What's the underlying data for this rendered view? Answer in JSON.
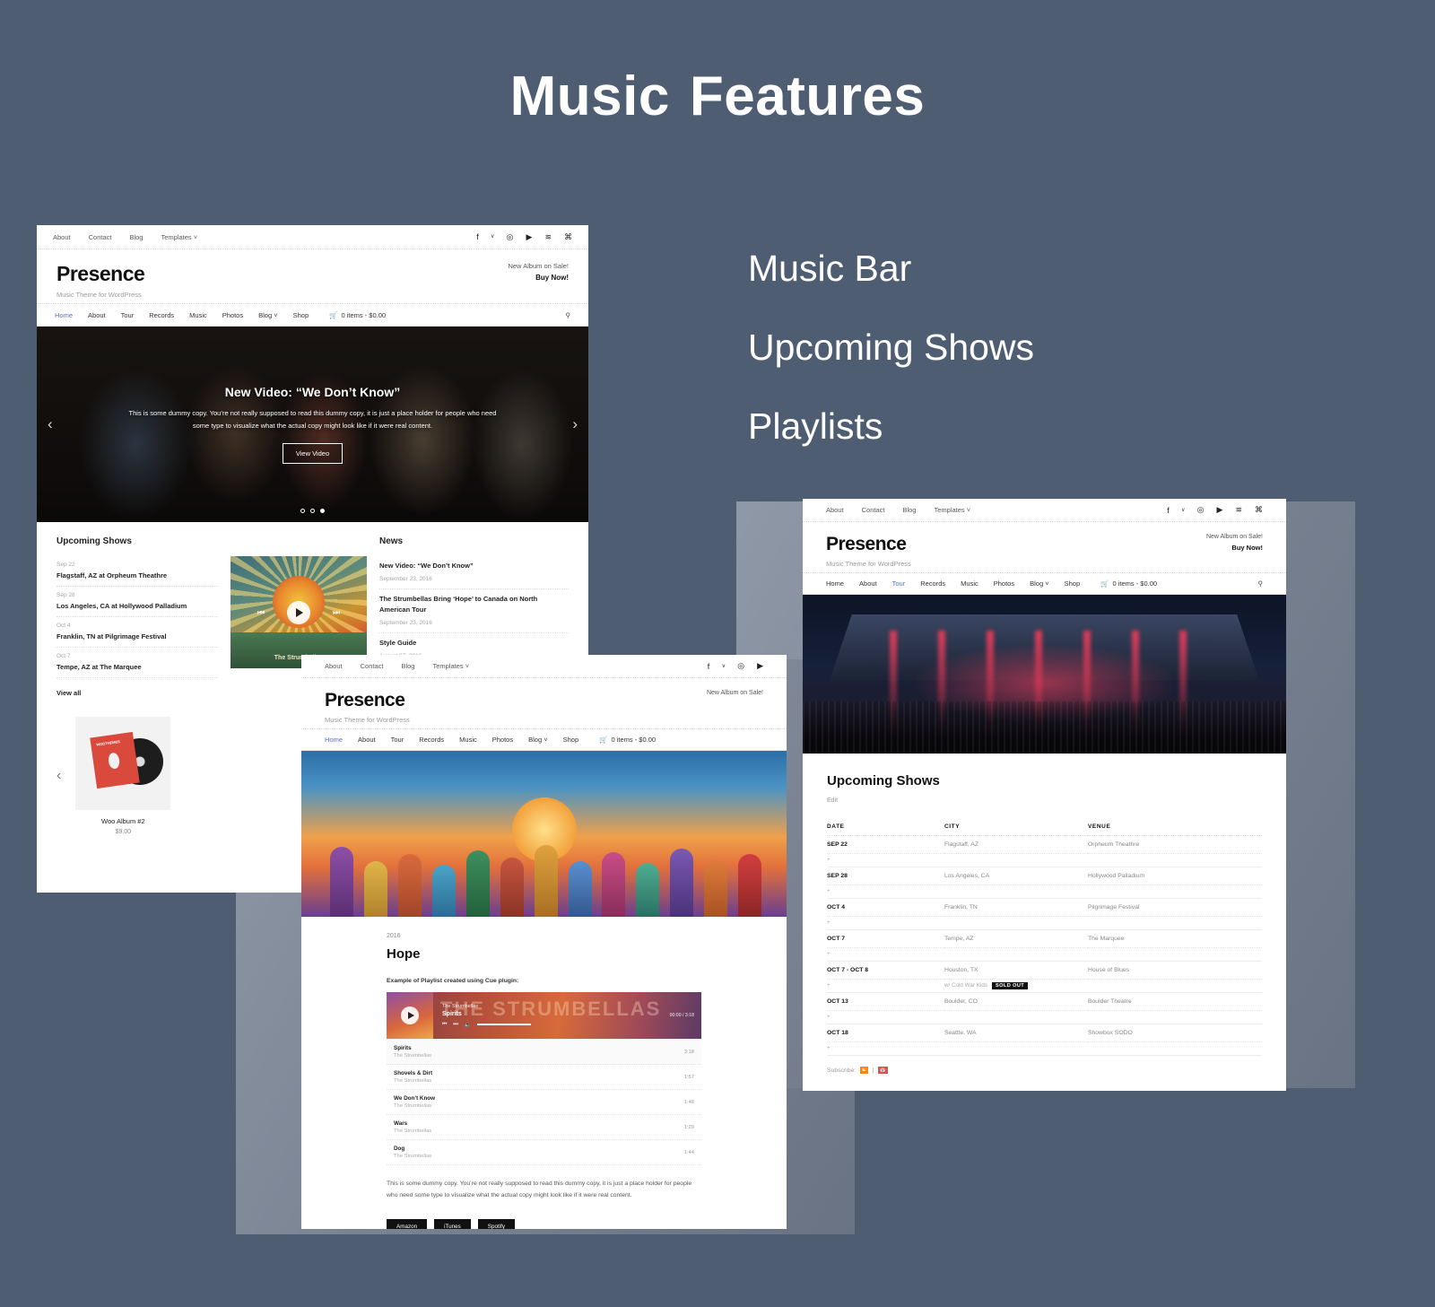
{
  "header": {
    "title_part1": "Music",
    "title_part2": "Features"
  },
  "features": [
    {
      "label": "Music Bar"
    },
    {
      "label": "Upcoming Shows"
    },
    {
      "label": "Playlists"
    }
  ],
  "site": {
    "brand": "Presence",
    "tagline": "Music Theme for WordPress",
    "promo_line1": "New Album on Sale!",
    "promo_line2": "Buy Now!",
    "topbar_links": [
      "About",
      "Contact",
      "Blog",
      "Templates ˅"
    ],
    "social_icons": [
      "facebook-icon",
      "twitter-icon",
      "instagram-icon",
      "youtube-icon",
      "soundcloud-icon",
      "apple-music-icon"
    ],
    "social_glyphs": [
      "f",
      "ᵛ",
      "◎",
      "▶",
      "≋",
      "⌘"
    ],
    "nav": [
      "Home",
      "About",
      "Tour",
      "Records",
      "Music",
      "Photos",
      "Blog ˅",
      "Shop"
    ],
    "cart": "0 items - $0.00",
    "cart_icon": "shopping-cart-icon",
    "search_icon": "search-icon"
  },
  "window1": {
    "active_nav": "Home",
    "hero": {
      "title": "New Video: “We Don’t Know”",
      "copy": "This is some dummy copy. You’re not really supposed to read this dummy copy, it is just a place holder for people who need some type to visualize what the actual copy might look like if it were real content.",
      "button": "View Video",
      "prev_icon": "chevron-left-icon",
      "next_icon": "chevron-right-icon",
      "slide_count": 3,
      "active_slide": 3
    },
    "shows_heading": "Upcoming Shows",
    "shows": [
      {
        "date": "Sep 22",
        "venue": "Flagstaff, AZ at Orpheum Theathre"
      },
      {
        "date": "Sep 28",
        "venue": "Los Angeles, CA at Hollywood Palladium"
      },
      {
        "date": "Oct 4",
        "venue": "Franklin, TN at Pilgrimage Festival"
      },
      {
        "date": "Oct 7",
        "venue": "Tempe, AZ at The Marquee"
      }
    ],
    "view_all": "View all",
    "album_art_caption": "The Strumbellas",
    "news_heading": "News",
    "news": [
      {
        "title": "New Video: “We Don’t Know”",
        "date": "September 23, 2016"
      },
      {
        "title": "The Strumbellas Bring ‘Hope’ to Canada on North American Tour",
        "date": "September 23, 2016"
      },
      {
        "title": "Style Guide",
        "date": "August 27, 2016"
      }
    ],
    "product": {
      "name": "Woo Album #2",
      "price": "$9.00",
      "sleeve_label": "WOOTHEMES",
      "prev_icon": "chevron-left-icon"
    }
  },
  "window2": {
    "active_nav": "Home",
    "year": "2016",
    "album_title": "Hope",
    "example_label": "Example of Playlist created using Cue plugin:",
    "player": {
      "artist": "The Strumbellas",
      "track": "Spirits",
      "time": "00:00 / 3:18",
      "marquee": "THE STRUMBELLAS",
      "prev_icon": "skip-back-icon",
      "next_icon": "skip-forward-icon",
      "volume_icon": "volume-icon"
    },
    "tracks": [
      {
        "name": "Spirits",
        "artist": "The Strumbellas",
        "dur": "3:18"
      },
      {
        "name": "Shovels & Dirt",
        "artist": "The Strumbellas",
        "dur": "1:57"
      },
      {
        "name": "We Don’t Know",
        "artist": "The Strumbellas",
        "dur": "1:48"
      },
      {
        "name": "Wars",
        "artist": "The Strumbellas",
        "dur": "1:29"
      },
      {
        "name": "Dog",
        "artist": "The Strumbellas",
        "dur": "1:44"
      }
    ],
    "copy": "This is some dummy copy. You’re not really supposed to read this dummy copy, it is just a place holder for people who need some type to visualize what the actual copy might look like if it were real content.",
    "buttons": [
      "Amazon",
      "iTunes",
      "Spotify"
    ]
  },
  "window3": {
    "active_nav": "Tour",
    "heading": "Upcoming Shows",
    "edit": "Edit",
    "columns": [
      "DATE",
      "CITY",
      "VENUE"
    ],
    "rows": [
      {
        "date": "SEP 22",
        "city": "Flagstaff, AZ",
        "venue": "Orpheum Theathre",
        "note": ""
      },
      {
        "date": "SEP 28",
        "city": "Los Angeles, CA",
        "venue": "Hollywood Palladium",
        "note": ""
      },
      {
        "date": "OCT 4",
        "city": "Franklin, TN",
        "venue": "Pilgrimage Festival",
        "note": ""
      },
      {
        "date": "OCT 7",
        "city": "Tempe, AZ",
        "venue": "The Marquee",
        "note": ""
      },
      {
        "date": "OCT 7 - OCT 8",
        "city": "Houston, TX",
        "venue": "House of Blues",
        "note": "w/ Cold War Kids",
        "badge": "SOLD OUT"
      },
      {
        "date": "OCT 13",
        "city": "Boulder, CO",
        "venue": "Boulder Theatre",
        "note": ""
      },
      {
        "date": "OCT 18",
        "city": "Seattle, WA",
        "venue": "Showbox SODO",
        "note": ""
      }
    ],
    "subscribe_label": "Subscribe:",
    "subscribe_icons": [
      "rss-icon",
      "calendar-icon"
    ]
  },
  "colors": {
    "background": "#4f5d73",
    "accent_link": "#5b6fd6",
    "badge": "#111111"
  }
}
